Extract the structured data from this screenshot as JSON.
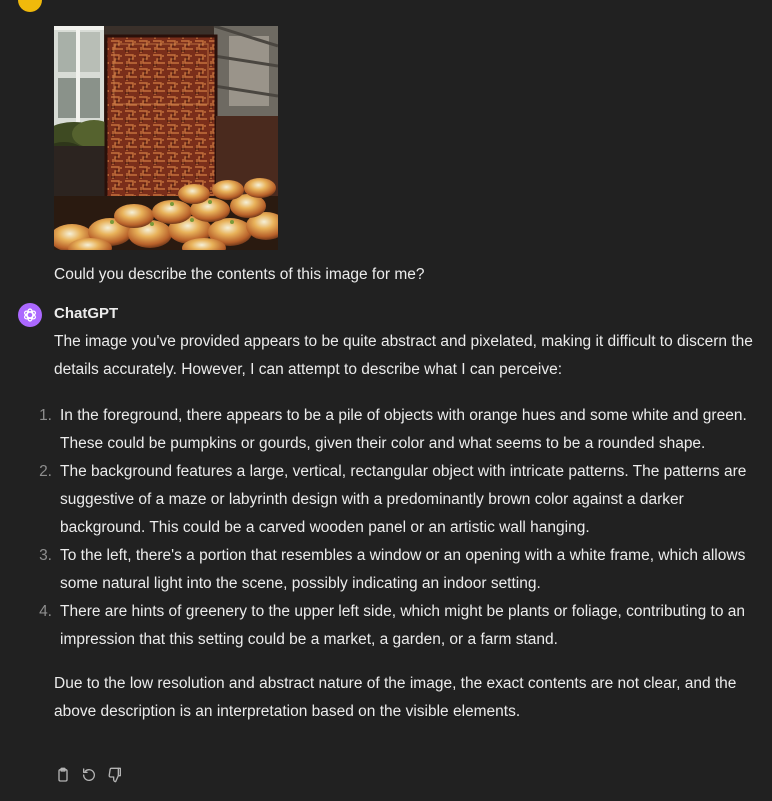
{
  "conversation": {
    "user": {
      "avatar_icon": "user-avatar",
      "avatar_color": "#f0b90b",
      "image_subject": "pumpkins-in-front-of-patterned-panel",
      "message": "Could you describe the contents of this image for me?"
    },
    "assistant": {
      "name": "ChatGPT",
      "avatar_icon": "openai-logo-icon",
      "avatar_color": "#ab68ff",
      "intro": "The image you've provided appears to be quite abstract and pixelated, making it difficult to discern the details accurately. However, I can attempt to describe what I can perceive:",
      "items": [
        {
          "num": "1.",
          "text": "In the foreground, there appears to be a pile of objects with orange hues and some white and green. These could be pumpkins or gourds, given their color and what seems to be a rounded shape."
        },
        {
          "num": "2.",
          "text": "The background features a large, vertical, rectangular object with intricate patterns. The patterns are suggestive of a maze or labyrinth design with a predominantly brown color against a darker background. This could be a carved wooden panel or an artistic wall hanging."
        },
        {
          "num": "3.",
          "text": "To the left, there's a portion that resembles a window or an opening with a white frame, which allows some natural light into the scene, possibly indicating an indoor setting."
        },
        {
          "num": "4.",
          "text": "There are hints of greenery to the upper left side, which might be plants or foliage, contributing to an impression that this setting could be a market, a garden, or a farm stand."
        }
      ],
      "conclusion": "Due to the low resolution and abstract nature of the image, the exact contents are not clear, and the above description is an interpretation based on the visible elements.",
      "actions": [
        {
          "icon": "clipboard-icon"
        },
        {
          "icon": "regenerate-icon"
        },
        {
          "icon": "thumbs-down-icon"
        }
      ]
    }
  },
  "theme": {
    "background": "#212121",
    "text": "#ececec",
    "muted": "#8e8e8e"
  }
}
